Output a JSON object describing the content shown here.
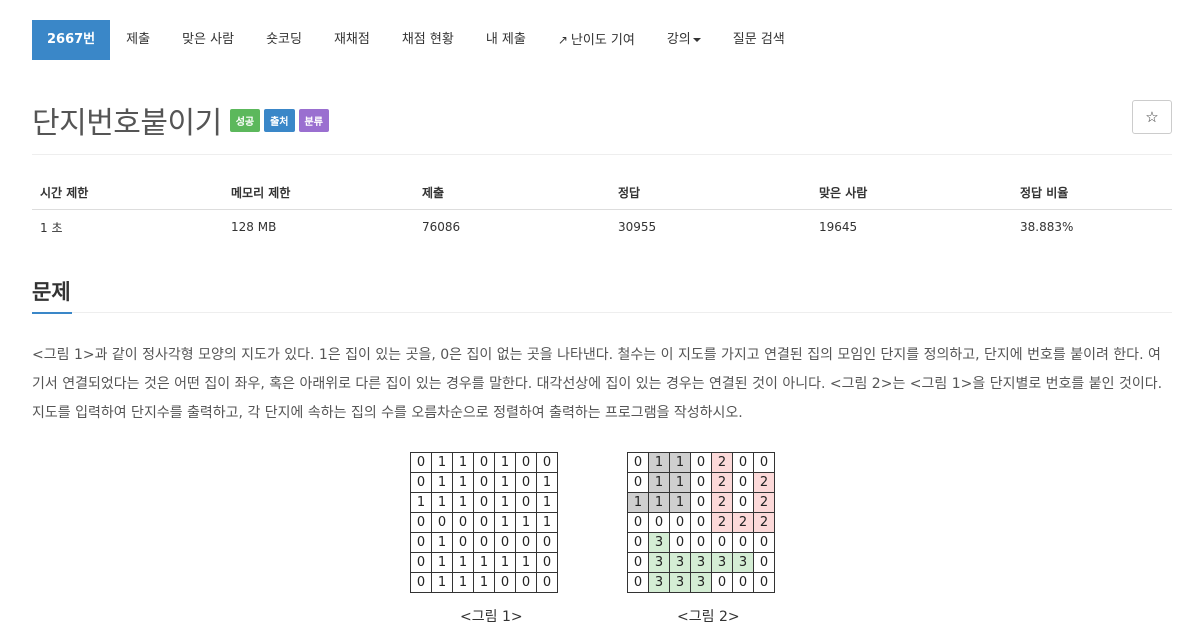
{
  "nav": {
    "problem_id": "2667번",
    "submit": "제출",
    "solved_users": "맞은 사람",
    "short_coding": "숏코딩",
    "rejudge": "재채점",
    "rejudge_status": "채점 현황",
    "my_submissions": "내 제출",
    "difficulty": "난이도 기여",
    "lecture": "강의",
    "question_search": "질문 검색"
  },
  "problem": {
    "title": "단지번호붙이기",
    "badges": [
      "성공",
      "출처",
      "분류"
    ],
    "star": "☆"
  },
  "stats": {
    "headers": [
      "시간 제한",
      "메모리 제한",
      "제출",
      "정답",
      "맞은 사람",
      "정답 비율"
    ],
    "values": [
      "1 초",
      "128 MB",
      "76086",
      "30955",
      "19645",
      "38.883%"
    ]
  },
  "section": {
    "title": "문제",
    "description": "<그림 1>과 같이 정사각형 모양의 지도가 있다. 1은 집이 있는 곳을, 0은 집이 없는 곳을 나타낸다. 철수는 이 지도를 가지고 연결된 집의 모임인 단지를 정의하고, 단지에 번호를 붙이려 한다. 여기서 연결되었다는 것은 어떤 집이 좌우, 혹은 아래위로 다른 집이 있는 경우를 말한다. 대각선상에 집이 있는 경우는 연결된 것이 아니다. <그림 2>는 <그림 1>을 단지별로 번호를 붙인 것이다. 지도를 입력하여 단지수를 출력하고, 각 단지에 속하는 집의 수를 오름차순으로 정렬하여 출력하는 프로그램을 작성하시오."
  },
  "figure1": {
    "caption": "<그림 1>",
    "rows": [
      [
        "0",
        "1",
        "1",
        "0",
        "1",
        "0",
        "0"
      ],
      [
        "0",
        "1",
        "1",
        "0",
        "1",
        "0",
        "1"
      ],
      [
        "1",
        "1",
        "1",
        "0",
        "1",
        "0",
        "1"
      ],
      [
        "0",
        "0",
        "0",
        "0",
        "1",
        "1",
        "1"
      ],
      [
        "0",
        "1",
        "0",
        "0",
        "0",
        "0",
        "0"
      ],
      [
        "0",
        "1",
        "1",
        "1",
        "1",
        "1",
        "0"
      ],
      [
        "0",
        "1",
        "1",
        "1",
        "0",
        "0",
        "0"
      ]
    ]
  },
  "figure2": {
    "caption": "<그림 2>",
    "rows": [
      [
        "0",
        "1",
        "1",
        "0",
        "2",
        "0",
        "0"
      ],
      [
        "0",
        "1",
        "1",
        "0",
        "2",
        "0",
        "2"
      ],
      [
        "1",
        "1",
        "1",
        "0",
        "2",
        "0",
        "2"
      ],
      [
        "0",
        "0",
        "0",
        "0",
        "2",
        "2",
        "2"
      ],
      [
        "0",
        "3",
        "0",
        "0",
        "0",
        "0",
        "0"
      ],
      [
        "0",
        "3",
        "3",
        "3",
        "3",
        "3",
        "0"
      ],
      [
        "0",
        "3",
        "3",
        "3",
        "0",
        "0",
        "0"
      ]
    ],
    "colors": {
      "1": "#cfcfcf",
      "2": "#fcd9d9",
      "3": "#d4edd4"
    }
  },
  "colors": {
    "accent": "#3a87c8",
    "success": "#5cb85c",
    "purple": "#9a6fd0"
  }
}
